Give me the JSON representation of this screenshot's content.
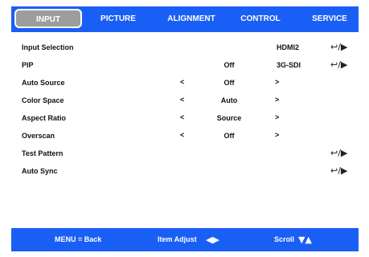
{
  "tabs": [
    "INPUT",
    "PICTURE",
    "ALIGNMENT",
    "CONTROL",
    "SERVICE"
  ],
  "active_tab": "INPUT",
  "rows": {
    "input_selection": {
      "label": "Input Selection",
      "source": "HDMI2",
      "action": "↩/▶"
    },
    "pip": {
      "label": "PIP",
      "value": "Off",
      "source": "3G-SDI",
      "action": "↩/▶"
    },
    "auto_source": {
      "label": "Auto Source",
      "left": "<",
      "value": "Off",
      "right": ">"
    },
    "color_space": {
      "label": "Color Space",
      "left": "<",
      "value": "Auto",
      "right": ">"
    },
    "aspect_ratio": {
      "label": "Aspect Ratio",
      "left": "<",
      "value": "Source",
      "right": ">"
    },
    "overscan": {
      "label": "Overscan",
      "left": "<",
      "value": "Off",
      "right": ">"
    },
    "test_pattern": {
      "label": "Test Pattern",
      "action": "↩/▶"
    },
    "auto_sync": {
      "label": "Auto Sync",
      "action": "↩/▶"
    }
  },
  "footer": {
    "menu": "MENU = Back",
    "adjust": "Item Adjust",
    "adjust_glyph": "◀▶",
    "scroll": "Scroll",
    "scroll_glyph": "▼▲"
  },
  "colors": {
    "bar": "#1a5ff5",
    "active_tab": "#9d9d9d"
  }
}
